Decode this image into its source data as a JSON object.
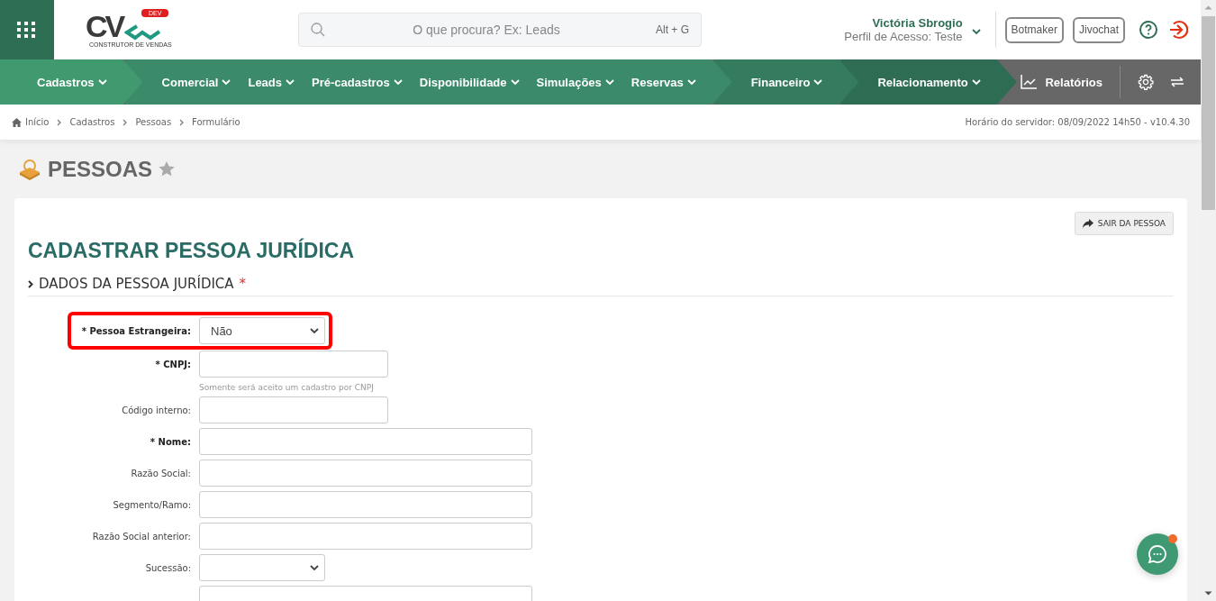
{
  "header": {
    "logo": {
      "mark": "CV",
      "badge": "DEV",
      "tagline": "CONSTRUTOR DE VENDAS"
    },
    "search": {
      "placeholder": "O que procura? Ex: Leads",
      "shortcut": "Alt + G"
    },
    "user": {
      "name": "Victória Sbrogio",
      "profile": "Perfil de Acesso: Teste"
    },
    "buttons": [
      "Botmaker",
      "Jivochat"
    ]
  },
  "nav": {
    "segments": [
      {
        "color": "#41996f",
        "items": [
          "Cadastros"
        ]
      },
      {
        "color": "#3b8a69",
        "items": [
          "Comercial",
          "Leads",
          "Pré-cadastros",
          "Disponibilidade",
          "Simulações",
          "Reservas"
        ]
      },
      {
        "color": "#357b5e",
        "items": [
          "Financeiro"
        ]
      },
      {
        "color": "#2e6d53",
        "items": [
          "Relacionamento"
        ]
      }
    ],
    "reports": "Relatórios"
  },
  "breadcrumbs": [
    "Início",
    "Cadastros",
    "Pessoas",
    "Formulário"
  ],
  "server_time": "Horário do servidor: 08/09/2022 14h50 - v10.4.30",
  "page": {
    "title": "PESSOAS",
    "favorite": false
  },
  "card": {
    "exit_button": "SAIR DA PESSOA",
    "heading": "CADASTRAR PESSOA JURÍDICA",
    "section": {
      "title": "DADOS DA PESSOA JURÍDICA",
      "required_mark": "*"
    },
    "fields": [
      {
        "kind": "select",
        "label": "* Pessoa Estrangeira:",
        "required": true,
        "highlighted": true,
        "value": "Não"
      },
      {
        "kind": "short",
        "label": "* CNPJ:",
        "required": true,
        "highlighted": false,
        "hint": "Somente será aceito um cadastro por CNPJ"
      },
      {
        "kind": "short",
        "label": "Código interno:",
        "required": false,
        "highlighted": false
      },
      {
        "kind": "long",
        "label": "* Nome:",
        "required": true,
        "highlighted": false
      },
      {
        "kind": "long",
        "label": "Razão Social:",
        "required": false,
        "highlighted": false
      },
      {
        "kind": "long",
        "label": "Segmento/Ramo:",
        "required": false,
        "highlighted": false
      },
      {
        "kind": "long",
        "label": "Razão Social anterior:",
        "required": false,
        "highlighted": false
      },
      {
        "kind": "select",
        "label": "Sucessão:",
        "required": false,
        "highlighted": false
      },
      {
        "kind": "long"
      }
    ]
  }
}
